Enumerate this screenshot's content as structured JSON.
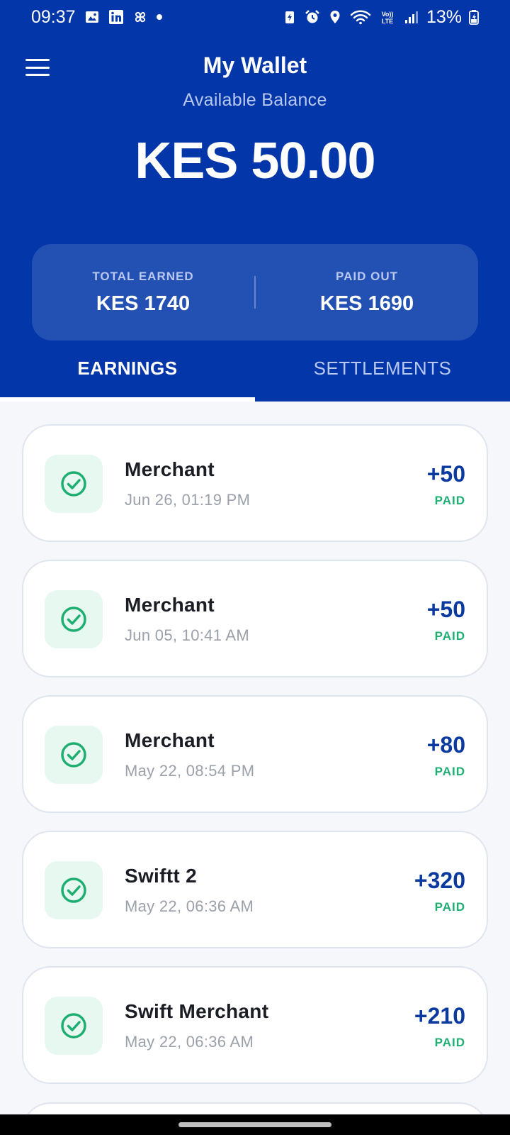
{
  "status_bar": {
    "time": "09:37",
    "battery": "13%"
  },
  "header": {
    "title": "My Wallet",
    "subtitle": "Available Balance",
    "balance": "KES 50.00"
  },
  "stats": {
    "total_earned_label": "TOTAL EARNED",
    "total_earned_value": "KES 1740",
    "paid_out_label": "PAID OUT",
    "paid_out_value": "KES 1690"
  },
  "tabs": [
    {
      "label": "EARNINGS",
      "active": true
    },
    {
      "label": "SETTLEMENTS",
      "active": false
    }
  ],
  "transactions": [
    {
      "name": "Merchant",
      "date": "Jun 26, 01:19 PM",
      "amount": "+50",
      "status": "PAID"
    },
    {
      "name": "Merchant",
      "date": "Jun 05, 10:41 AM",
      "amount": "+50",
      "status": "PAID"
    },
    {
      "name": "Merchant",
      "date": "May 22, 08:54 PM",
      "amount": "+80",
      "status": "PAID"
    },
    {
      "name": "Swiftt 2",
      "date": "May 22, 06:36 AM",
      "amount": "+320",
      "status": "PAID"
    },
    {
      "name": "Swift Merchant",
      "date": "May 22, 06:36 AM",
      "amount": "+210",
      "status": "PAID"
    }
  ],
  "colors": {
    "header_bg": "#0336a8",
    "amount": "#0a3aa0",
    "paid": "#1fae72"
  },
  "icons": {
    "menu": "hamburger-menu-icon",
    "transaction": "check-circle-icon"
  }
}
